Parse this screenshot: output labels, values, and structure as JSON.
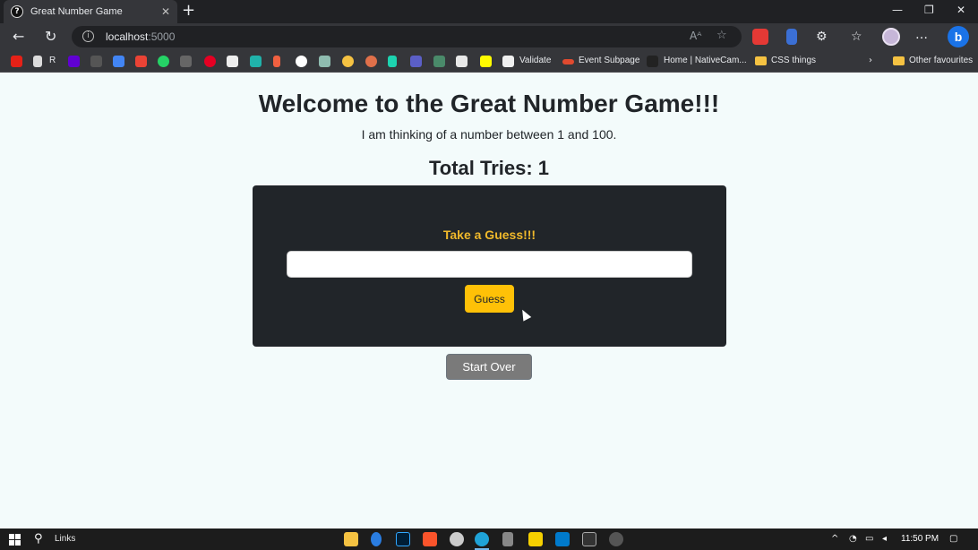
{
  "browser": {
    "tab_title": "Great Number Game",
    "url_host": "localhost",
    "url_port": ":5000",
    "bookmarks": [
      {
        "label": "R"
      },
      {
        "label": "Validate"
      },
      {
        "label": "Event Subpage"
      },
      {
        "label": "Home | NativeCam..."
      },
      {
        "label": "CSS things"
      }
    ],
    "other_favourites": "Other favourites"
  },
  "page": {
    "title": "Welcome to the Great Number Game!!!",
    "subtitle": "I am thinking of a number between 1 and 100.",
    "tries_label": "Total Tries: 1",
    "prompt": "Take a Guess!!!",
    "guess_value": "",
    "guess_button": "Guess",
    "start_over_button": "Start Over"
  },
  "taskbar": {
    "search_label": "Links",
    "time": "11:50 PM"
  },
  "colors": {
    "accent": "#ffc107",
    "prompt": "#f0b92b",
    "card": "#212529",
    "background": "#f3fbfb"
  }
}
